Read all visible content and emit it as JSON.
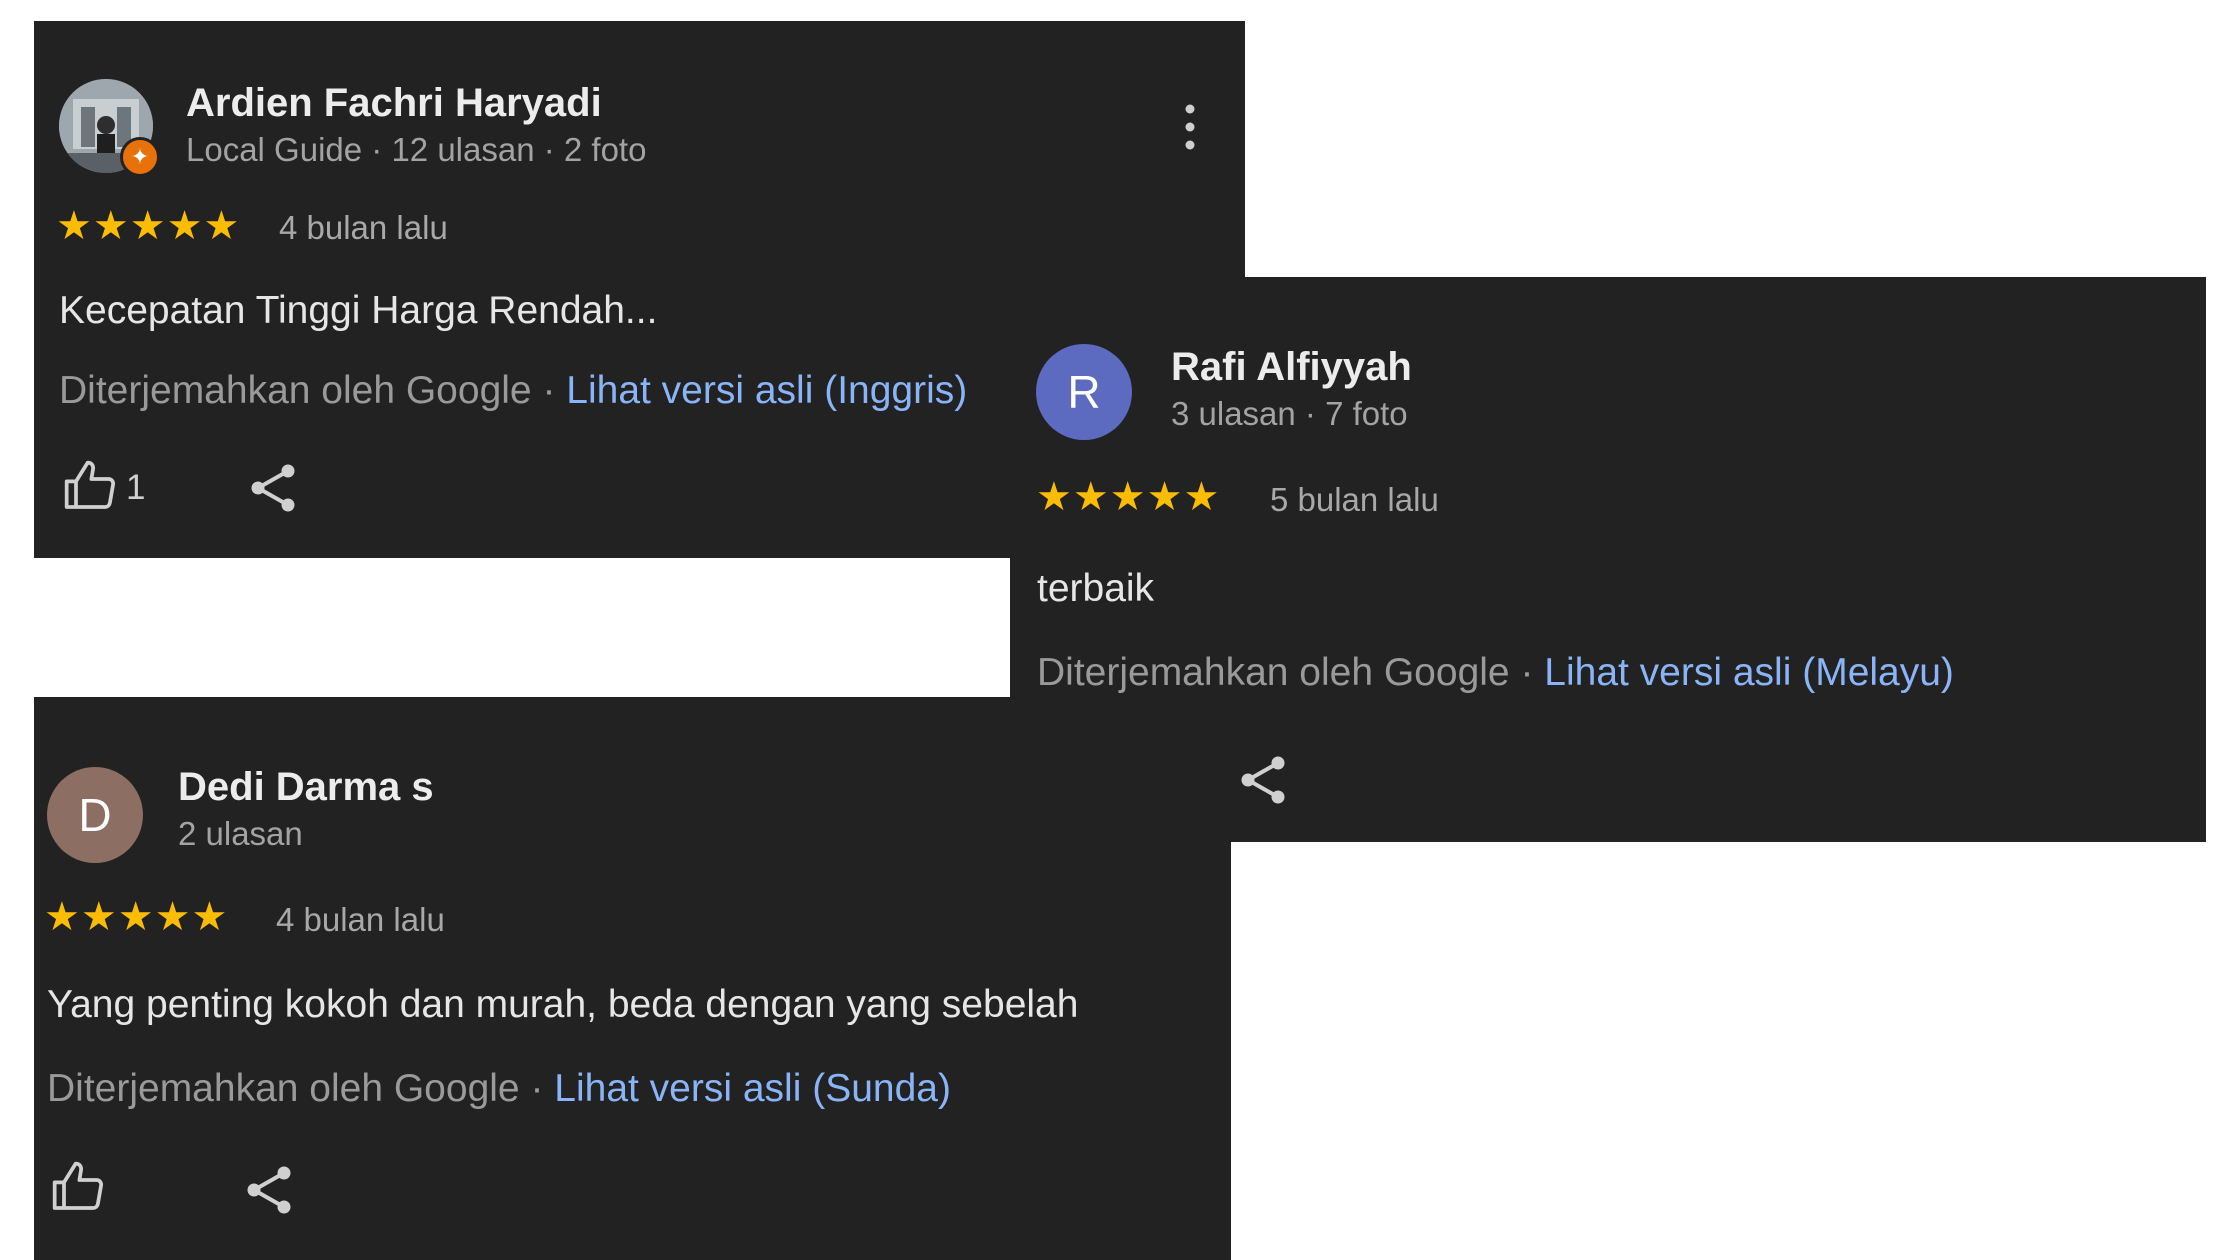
{
  "reviews": [
    {
      "name": "Ardien Fachri Haryadi",
      "meta": "Local Guide · 12 ulasan · 2 foto",
      "stars": "★★★★★",
      "time": "4 bulan lalu",
      "text": "Kecepatan Tinggi Harga Rendah...",
      "translated": "Diterjemahkan oleh Google",
      "separator": " · ",
      "link": "Lihat versi asli (Inggris)",
      "like_count": "1",
      "rating": 5,
      "icons": [
        "profile-photo",
        "local-guide-badge-icon",
        "more-vert-icon",
        "thumb-up-icon",
        "share-icon"
      ]
    },
    {
      "name": "Rafi Alfiyyah",
      "meta": "3 ulasan · 7 foto",
      "initial": "R",
      "avatar_color": "#5c6bc0",
      "stars": "★★★★★",
      "time": "5 bulan lalu",
      "text": "terbaik",
      "translated": "Diterjemahkan oleh Google",
      "separator": " · ",
      "link": "Lihat versi asli (Melayu)",
      "rating": 5,
      "icons": [
        "share-icon"
      ]
    },
    {
      "name": "Dedi Darma s",
      "meta": "2 ulasan",
      "initial": "D",
      "avatar_color": "#8d6e63",
      "stars": "★★★★★",
      "time": "4 bulan lalu",
      "text": "Yang penting kokoh dan murah, beda dengan yang sebelah",
      "translated": "Diterjemahkan oleh Google",
      "separator": " · ",
      "link": "Lihat versi asli (Sunda)",
      "rating": 5,
      "icons": [
        "thumb-up-icon",
        "share-icon"
      ]
    }
  ],
  "colors": {
    "card_background": "#222222",
    "star": "#fbbc04",
    "link": "#8ab4f8",
    "page_background": "#ffffff"
  }
}
